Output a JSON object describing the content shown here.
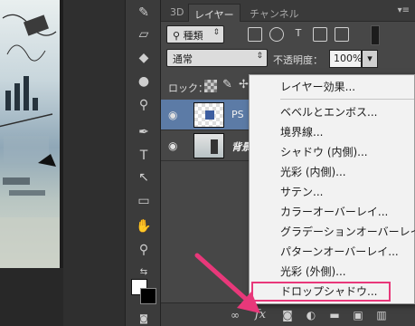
{
  "tabs": [
    {
      "label": "3D",
      "active": false
    },
    {
      "label": "レイヤー",
      "active": true
    },
    {
      "label": "チャンネル",
      "active": false
    }
  ],
  "panel_menu_icon": "panel-menu-icon",
  "filter": {
    "kind_label": "種類"
  },
  "blend": {
    "mode": "通常",
    "opacity_label": "不透明度：",
    "opacity_value": "100%"
  },
  "lock": {
    "label": "ロック："
  },
  "layers": [
    {
      "name": "PS",
      "selected": true
    },
    {
      "name": "背景",
      "selected": false
    }
  ],
  "fx_menu": {
    "items": [
      "レイヤー効果...",
      "ベベルとエンボス...",
      "境界線...",
      "シャドウ (内側)...",
      "光彩 (内側)...",
      "サテン...",
      "カラーオーバーレイ...",
      "グラデーションオーバーレイ...",
      "パターンオーバーレイ...",
      "光彩 (外側)...",
      "ドロップシャドウ..."
    ],
    "highlighted_index": 10
  },
  "footer": {
    "fx_label": "fx"
  },
  "colors": {
    "highlight": "#e8387a",
    "selected_layer": "#5c7ba6",
    "arrow": "#e8387a"
  }
}
